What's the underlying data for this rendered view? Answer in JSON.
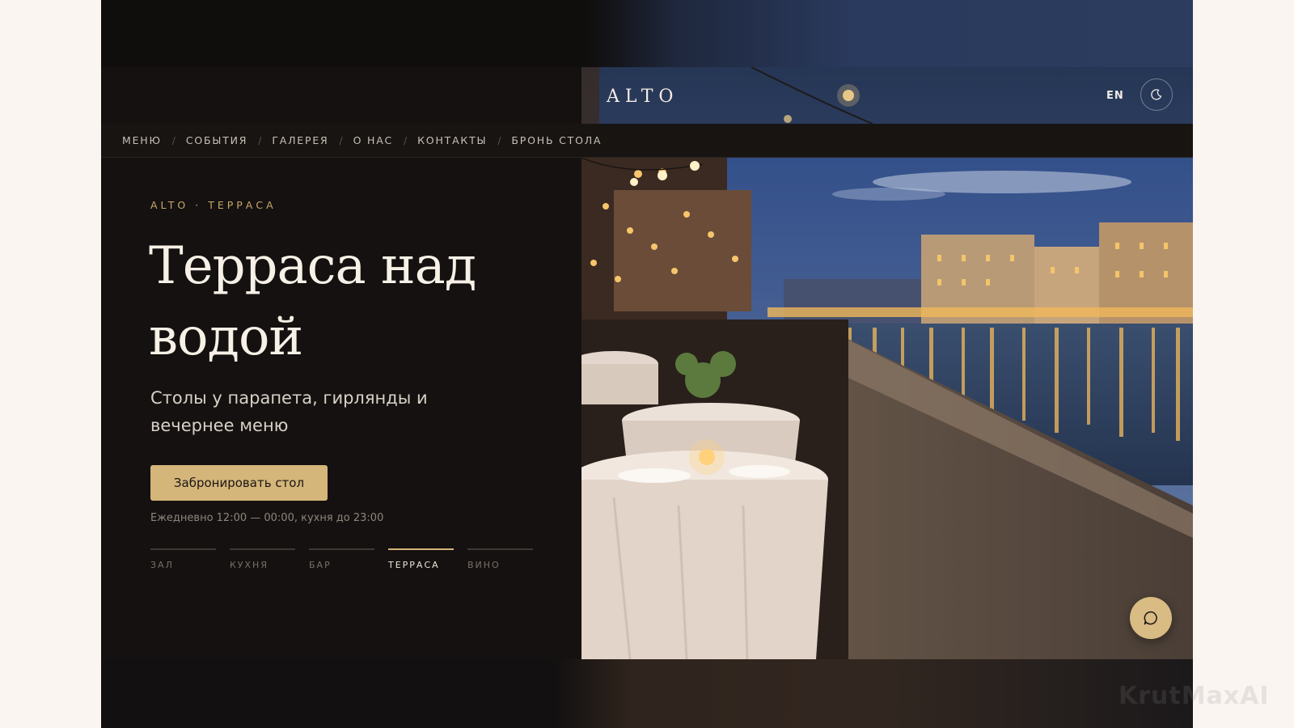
{
  "brand": {
    "logo": "ALTO"
  },
  "header": {
    "lang": "EN"
  },
  "nav": {
    "items": [
      {
        "label": "МЕНЮ"
      },
      {
        "label": "СОБЫТИЯ"
      },
      {
        "label": "ГАЛЕРЕЯ"
      },
      {
        "label": "О НАС"
      },
      {
        "label": "КОНТАКТЫ"
      },
      {
        "label": "БРОНЬ СТОЛА"
      }
    ],
    "separator": "/"
  },
  "hero": {
    "eyebrow": "ALTO · ТЕРРАСА",
    "title_line1": "Терраса над",
    "title_line2": "водой",
    "subtitle": "Столы у парапета, гирлянды и вечернее меню",
    "cta_label": "Забронировать стол",
    "hours": "Ежедневно 12:00 — 00:00, кухня до 23:00"
  },
  "tabs": [
    {
      "label": "ЗАЛ",
      "active": false
    },
    {
      "label": "КУХНЯ",
      "active": false
    },
    {
      "label": "БАР",
      "active": false
    },
    {
      "label": "ТЕРРАСА",
      "active": true
    },
    {
      "label": "ВИНО",
      "active": false
    }
  ],
  "watermark": "KrutMaxAI",
  "icons": {
    "theme": "moon-icon",
    "chat": "chat-bubble-icon"
  },
  "colors": {
    "accent": "#d4b57a",
    "background": "#141110",
    "text": "#f6f0e6"
  }
}
